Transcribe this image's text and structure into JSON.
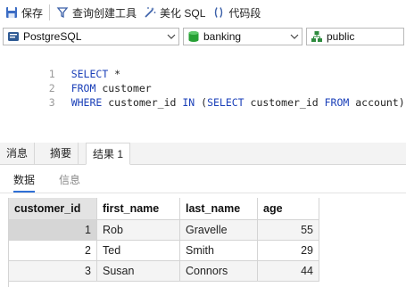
{
  "toolbar": {
    "save": "保存",
    "query_builder": "查询创建工具",
    "beautify": "美化 SQL",
    "snippet": "代码段"
  },
  "selectors": {
    "connection": "PostgreSQL",
    "database": "banking",
    "schema": "public"
  },
  "editor": {
    "lines": [
      {
        "num": "1",
        "kw1": "SELECT",
        "t1": " *",
        "kw2": "",
        "t2": "",
        "kw3": "",
        "t3": "",
        "kw4": "",
        "t4": ""
      },
      {
        "num": "2",
        "kw1": "FROM",
        "t1": " customer",
        "kw2": "",
        "t2": "",
        "kw3": "",
        "t3": "",
        "kw4": "",
        "t4": ""
      },
      {
        "num": "3",
        "kw1": "WHERE",
        "t1": " customer_id ",
        "kw2": "IN",
        "t2": " (",
        "kw3": "SELECT",
        "t3": " customer_id ",
        "kw4": "FROM",
        "t4": " account);"
      }
    ]
  },
  "tabs": [
    "消息",
    "摘要",
    "结果 1"
  ],
  "subtabs": [
    "数据",
    "信息"
  ],
  "grid": {
    "columns": [
      "customer_id",
      "first_name",
      "last_name",
      "age"
    ],
    "rows": [
      [
        "1",
        "Rob",
        "Gravelle",
        "55"
      ],
      [
        "2",
        "Ted",
        "Smith",
        "29"
      ],
      [
        "3",
        "Susan",
        "Connors",
        "44"
      ]
    ]
  },
  "icons": {
    "save": "save-icon",
    "query_builder": "query-builder-icon",
    "beautify": "magic-wand-icon",
    "snippet": "code-snippet-icon",
    "connection": "postgresql-icon",
    "database": "database-icon",
    "schema": "schema-icon",
    "dropdown": "chevron-down-icon"
  },
  "colors": {
    "keyword": "#1a3fb8",
    "accent": "#2f6fd6",
    "database_icon": "#27a035"
  }
}
